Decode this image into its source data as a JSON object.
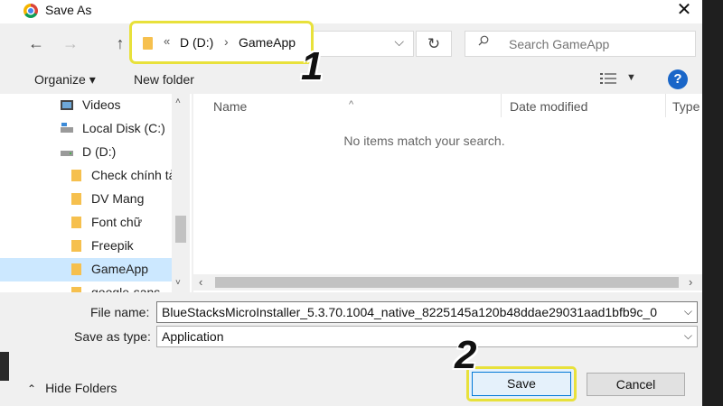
{
  "window": {
    "title": "Save As",
    "close_glyph": "✕"
  },
  "address": {
    "overflow_glyph": "«",
    "drive": "D (D:)",
    "separator": "›",
    "folder": "GameApp",
    "dropdown_glyph": "⌵"
  },
  "nav_glyphs": {
    "back": "←",
    "forward": "→",
    "up": "↑",
    "refresh": "↻"
  },
  "search": {
    "placeholder": "Search GameApp"
  },
  "toolbar": {
    "organize": "Organize ▾",
    "new_folder": "New folder",
    "view_dropdown": "▼",
    "help": "?"
  },
  "annotations": {
    "step1": "1",
    "step2": "2"
  },
  "sidebar": {
    "items": [
      {
        "label": "Videos",
        "icon": "video-icon"
      },
      {
        "label": "Local Disk (C:)",
        "icon": "drive-icon"
      },
      {
        "label": "D (D:)",
        "icon": "drive-icon"
      },
      {
        "label": "Check chính tả",
        "icon": "folder-icon"
      },
      {
        "label": "DV Mang",
        "icon": "folder-icon"
      },
      {
        "label": "Font chữ",
        "icon": "folder-icon"
      },
      {
        "label": "Freepik",
        "icon": "folder-icon"
      },
      {
        "label": "GameApp",
        "icon": "folder-icon",
        "selected": true
      },
      {
        "label": "google-sans",
        "icon": "folder-icon"
      }
    ],
    "scroll_up": "˄",
    "scroll_down": "˅"
  },
  "file_list": {
    "columns": [
      "Name",
      "Date modified",
      "Type"
    ],
    "sort_glyph": "^",
    "empty_message": "No items match your search.",
    "scroll_left": "‹",
    "scroll_right": "›"
  },
  "form": {
    "file_name_label": "File name:",
    "file_name_value": "BlueStacksMicroInstaller_5.3.70.1004_native_8225145a120b48ddae29031aad1bfb9c_0",
    "save_type_label": "Save as type:",
    "save_type_value": "Application",
    "dropdown_glyph": "⌵"
  },
  "footer": {
    "hide_folders": "Hide Folders",
    "hide_chevron": "⌃",
    "save": "Save",
    "cancel": "Cancel"
  },
  "colors": {
    "highlight": "#e8e13b",
    "selection": "#cce8ff",
    "accent": "#0078d7",
    "help": "#1a66c8"
  }
}
